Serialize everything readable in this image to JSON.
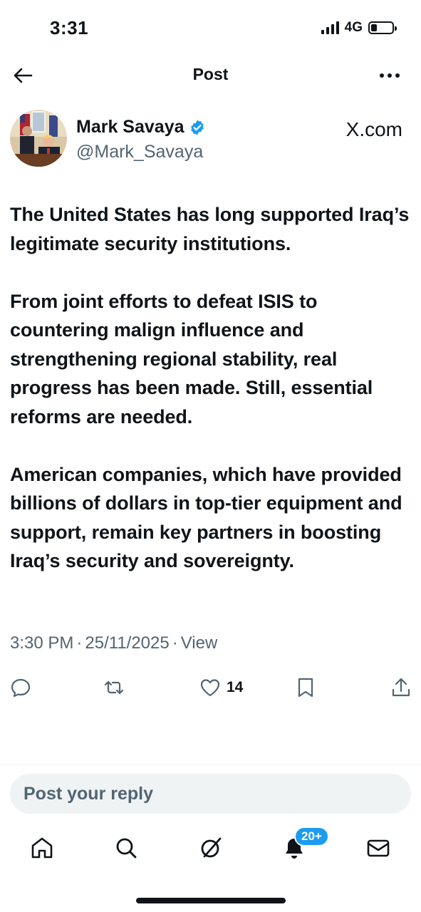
{
  "status_bar": {
    "time": "3:31",
    "network": "4G",
    "battery_level": 0.3
  },
  "header": {
    "title": "Post",
    "back_icon": "arrow-left-icon",
    "more_icon": "more-horizontal-icon"
  },
  "author": {
    "name": "Mark Savaya",
    "handle": "@Mark_Savaya",
    "verified": true,
    "source": "X.com"
  },
  "post": {
    "paragraphs": [
      "The United States has long supported Iraq’s legitimate security institutions.",
      "From joint efforts to defeat ISIS to countering malign influence and strengthening regional stability, real progress has been made. Still, essential reforms are needed.",
      "American companies, which have provided billions of dollars in top-tier equipment and support, remain key partners in boosting Iraq’s security and sovereignty."
    ],
    "time": "3:30 PM",
    "date": "25/11/2025",
    "views_label": "View"
  },
  "actions": {
    "reply_icon": "reply-icon",
    "repost_icon": "repost-icon",
    "like_icon": "heart-icon",
    "like_count": "14",
    "bookmark_icon": "bookmark-icon",
    "share_icon": "share-icon"
  },
  "reply": {
    "placeholder": "Post your reply"
  },
  "bottom_nav": {
    "items": [
      "home-icon",
      "search-icon",
      "grok-icon",
      "notifications-icon",
      "messages-icon"
    ],
    "notification_badge": "20+"
  },
  "colors": {
    "text": "#0f1419",
    "secondary": "#536471",
    "accent": "#1d9bf0",
    "reply_bg": "#eff3f4"
  }
}
